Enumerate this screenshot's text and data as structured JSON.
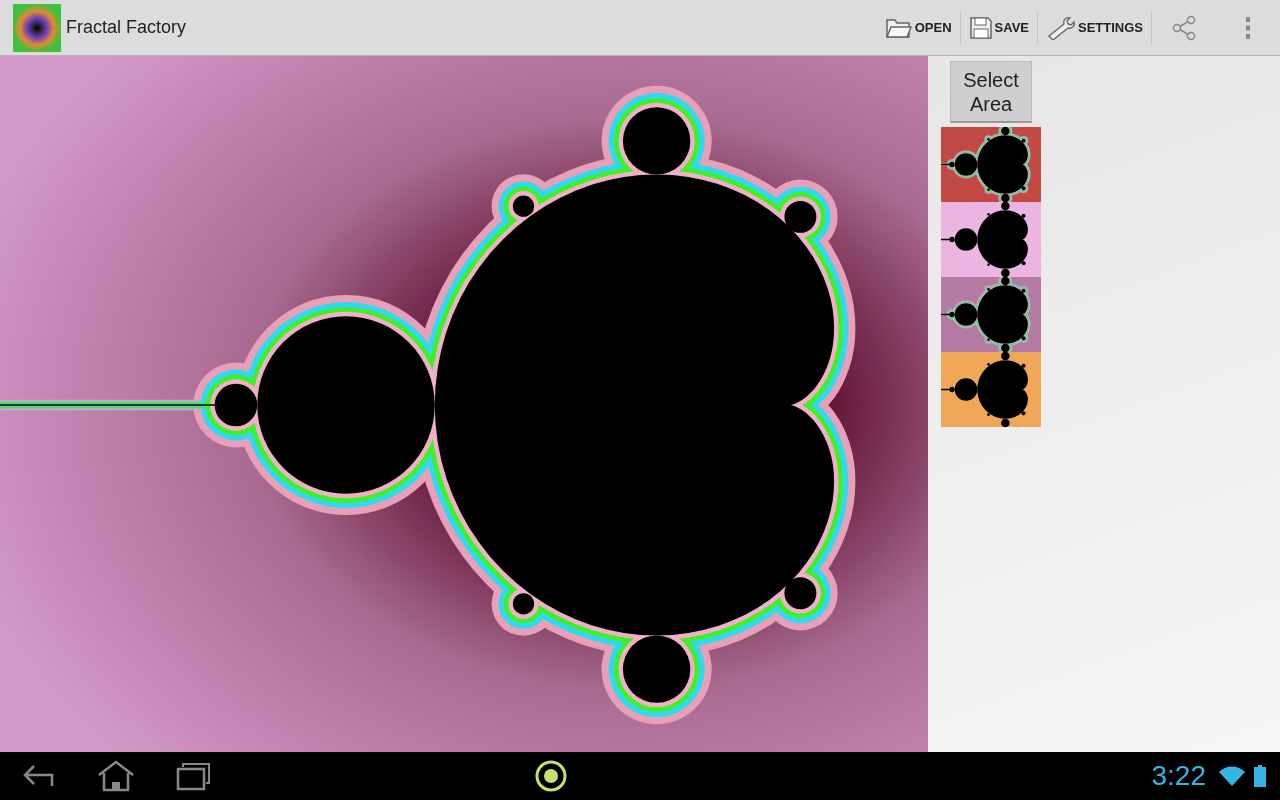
{
  "app_bar": {
    "title": "Fractal Factory",
    "actions": [
      {
        "kind": "open",
        "label": "OPEN"
      },
      {
        "kind": "save",
        "label": "SAVE"
      },
      {
        "kind": "settings",
        "label": "SETTINGS"
      }
    ]
  },
  "side_panel": {
    "button": "Select Area",
    "thumbnails": [
      {
        "color": "#c14a44"
      },
      {
        "color": "#ecb4e0"
      },
      {
        "color": "#b47aa4"
      },
      {
        "color": "#f0a858"
      }
    ]
  },
  "nav_bar": {
    "time": "3:22"
  }
}
